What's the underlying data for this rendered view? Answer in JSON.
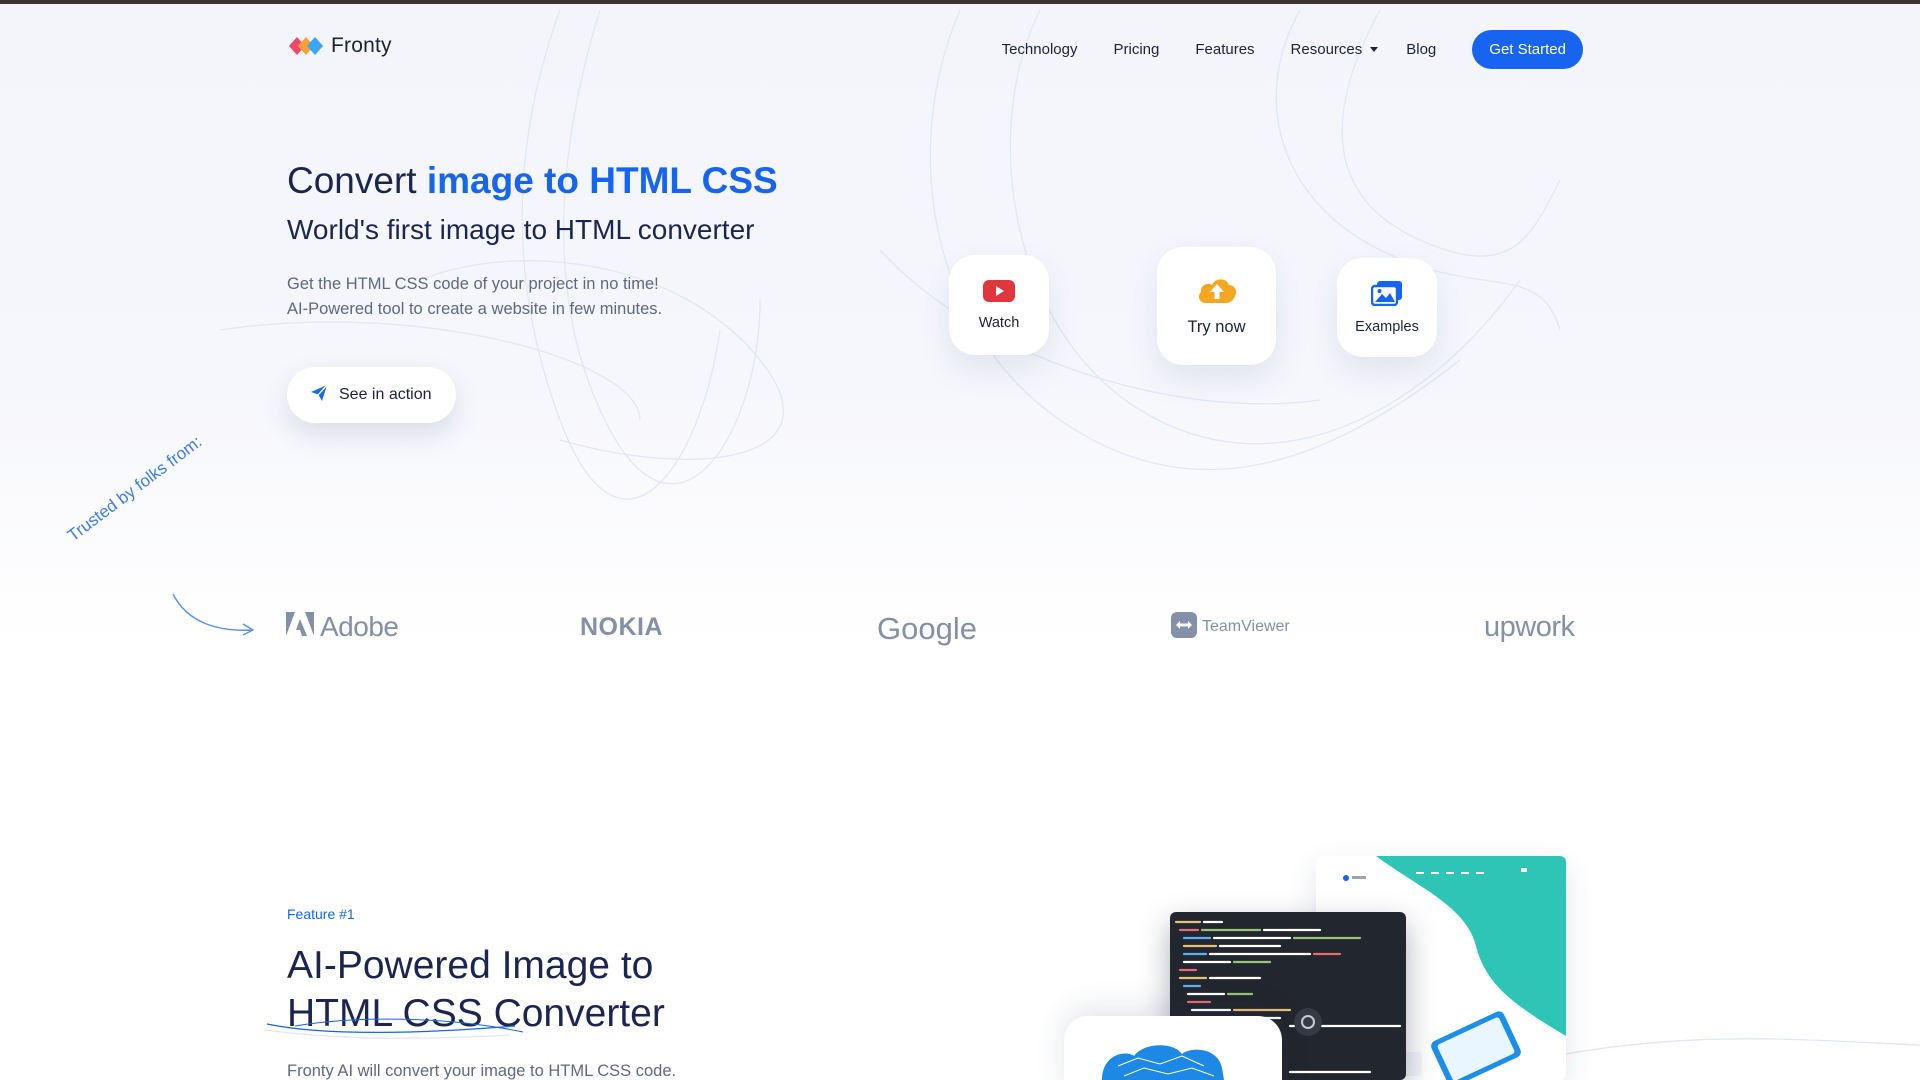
{
  "brand": {
    "name": "Fronty"
  },
  "nav": {
    "items": [
      "Technology",
      "Pricing",
      "Features",
      "Resources",
      "Blog"
    ],
    "cta": "Get Started"
  },
  "hero": {
    "title_prefix": "Convert ",
    "title_accent": "image to HTML CSS",
    "subtitle": "World's first image to HTML converter",
    "desc_line1": "Get the HTML CSS code of your project in no time!",
    "desc_line2": "AI-Powered tool to create a website in few minutes.",
    "action_label": "See in action"
  },
  "cards": {
    "watch": "Watch",
    "try": "Try now",
    "examples": "Examples"
  },
  "trusted": {
    "label": "Trusted by folks from:",
    "brands": [
      "Adobe",
      "NOKIA",
      "Google",
      "TeamViewer",
      "upwork"
    ]
  },
  "feature": {
    "tag": "Feature #1",
    "title_line1": "AI-Powered Image to",
    "title_line2": "HTML CSS Converter",
    "desc": "Fronty AI will convert your image to HTML CSS code."
  },
  "colors": {
    "accent": "#1664f0",
    "dark": "#1b2550",
    "muted": "#5e6783",
    "watch_red": "#e0363d",
    "upload_orange": "#f5a623"
  },
  "icons": {
    "action": "paper-plane-icon",
    "watch": "youtube-play-icon",
    "try": "cloud-upload-icon",
    "examples": "images-icon",
    "trusted": "curved-arrow-icon"
  }
}
